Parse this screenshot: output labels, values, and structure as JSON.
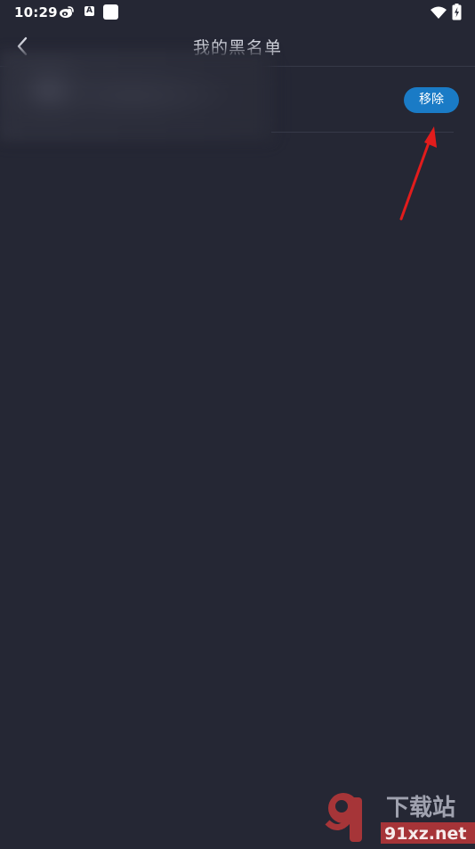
{
  "status_bar": {
    "time": "10:29",
    "icons": [
      "weibo-icon",
      "a-icon",
      "square-icon",
      "wifi-icon",
      "battery-charging-icon"
    ],
    "a_letter": "A"
  },
  "header": {
    "back_icon": "chevron-left-icon",
    "title": "我的黑名单"
  },
  "blacklist": {
    "items": [
      {
        "user_blurred": true,
        "action_label": "移除"
      }
    ]
  },
  "colors": {
    "background": "#252734",
    "button": "#1a7bc6",
    "annotation": "#e21c1c",
    "title": "#d7d9e2"
  },
  "watermark": {
    "logo": "91",
    "text_cn": "下载站",
    "text_en": "91xz.net"
  }
}
